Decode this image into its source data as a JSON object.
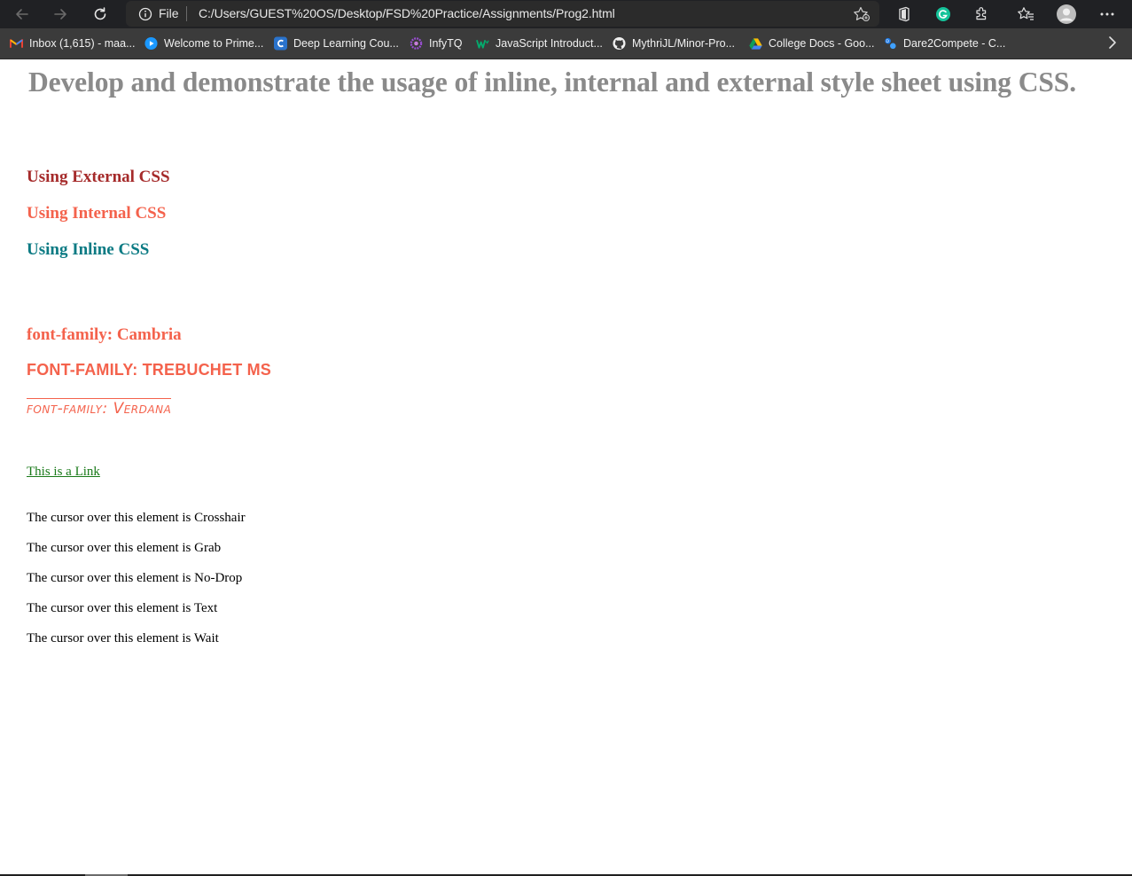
{
  "browser": {
    "address": {
      "scheme_label": "File",
      "url": "C:/Users/GUEST%20OS/Desktop/FSD%20Practice/Assignments/Prog2.html"
    },
    "bookmarks": [
      {
        "label": "Inbox (1,615) - maa...",
        "icon": "gmail-icon"
      },
      {
        "label": "Welcome to Prime...",
        "icon": "prime-video-icon"
      },
      {
        "label": "Deep Learning  Cou...",
        "icon": "coursera-icon"
      },
      {
        "label": "InfyTQ",
        "icon": "infytq-icon"
      },
      {
        "label": "JavaScript Introduct...",
        "icon": "w3-icon"
      },
      {
        "label": "MythriJL/Minor-Pro...",
        "icon": "github-icon"
      },
      {
        "label": "College Docs - Goo...",
        "icon": "google-drive-icon"
      },
      {
        "label": "Dare2Compete - C...",
        "icon": "dare2compete-icon"
      }
    ],
    "colors": {
      "chrome_dark": "#202124",
      "bookmarks_bar": "#3b3b3b"
    }
  },
  "page": {
    "heading": "Develop and demonstrate the usage of inline, internal and external style sheet using CSS.",
    "external_css": "Using External CSS",
    "internal_css": "Using Internal CSS",
    "inline_css": "Using Inline CSS",
    "font_cambria": "font-family: Cambria",
    "font_trebuchet": "font-family: Trebuchet MS",
    "font_verdana": "font-family: Verdana",
    "link": "This is a Link",
    "cursor_lines": [
      "The cursor over this element is Crosshair",
      "The cursor over this element is Grab",
      "The cursor over this element is No-Drop",
      "The cursor over this element is Text",
      "The cursor over this element is Wait"
    ],
    "colors": {
      "heading": "#8a8a8a",
      "external": "#a52a2a",
      "coral": "#f4624c",
      "inline": "#0b7a83",
      "link": "#1a7a1a"
    }
  }
}
